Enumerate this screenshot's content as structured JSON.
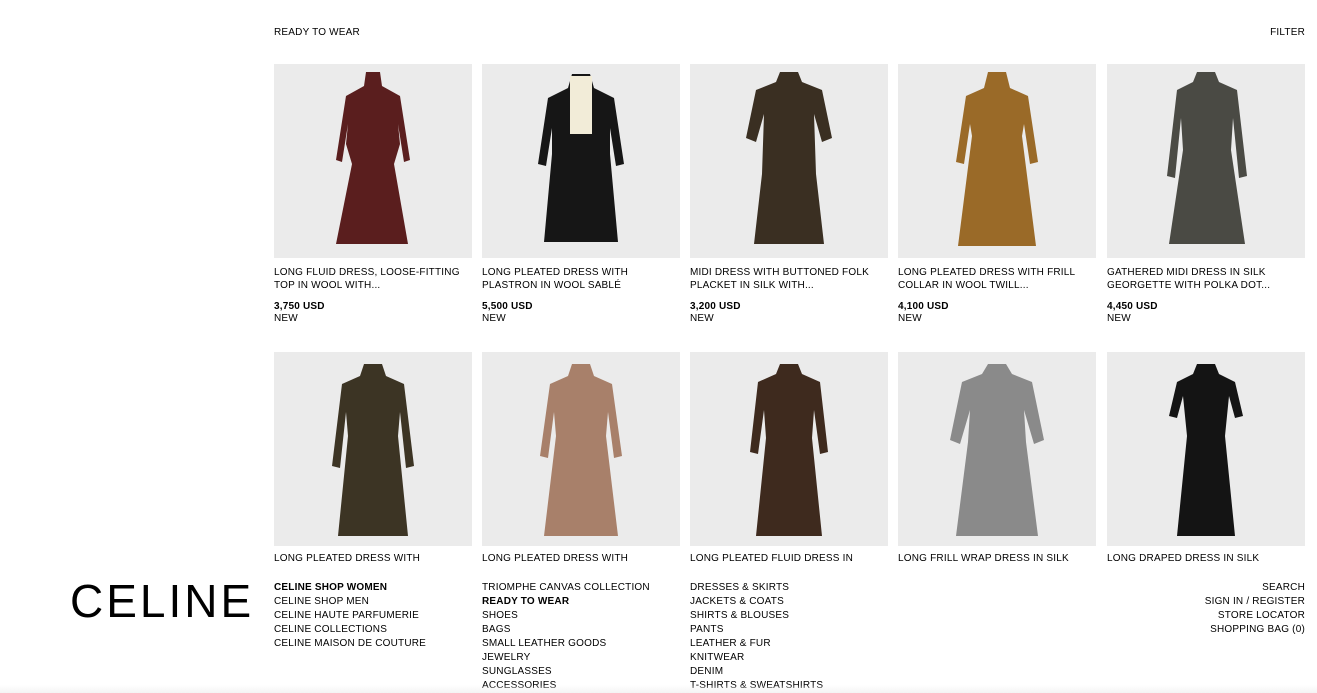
{
  "header": {
    "title": "READY TO WEAR",
    "filter_label": "FILTER"
  },
  "products_row1": [
    {
      "name": "LONG FLUID DRESS, LOOSE-FITTING TOP IN WOOL WITH...",
      "price": "3,750 USD",
      "badge": "NEW",
      "color": "#5a1e1e"
    },
    {
      "name": "LONG PLEATED DRESS WITH PLASTRON IN WOOL SABLÉ",
      "price": "5,500 USD",
      "badge": "NEW",
      "color": "#161616"
    },
    {
      "name": "MIDI DRESS WITH BUTTONED FOLK PLACKET IN SILK WITH...",
      "price": "3,200 USD",
      "badge": "NEW",
      "color": "#3a2f22"
    },
    {
      "name": "LONG PLEATED DRESS WITH FRILL COLLAR IN WOOL TWILL...",
      "price": "4,100 USD",
      "badge": "NEW",
      "color": "#9a6a28"
    },
    {
      "name": "GATHERED MIDI DRESS IN SILK GEORGETTE WITH POLKA DOT...",
      "price": "4,450 USD",
      "badge": "NEW",
      "color": "#4a4a44"
    }
  ],
  "products_row2": [
    {
      "name": "LONG PLEATED DRESS WITH",
      "color": "#3c3424"
    },
    {
      "name": "LONG PLEATED DRESS WITH",
      "color": "#a8806a"
    },
    {
      "name": "LONG PLEATED FLUID DRESS IN",
      "color": "#3e2a1e"
    },
    {
      "name": "LONG FRILL WRAP DRESS IN SILK",
      "color": "#8a8a8a"
    },
    {
      "name": "LONG DRAPED DRESS IN SILK",
      "color": "#141414"
    }
  ],
  "footer": {
    "logo": "CELINE",
    "col1": [
      "CELINE SHOP WOMEN",
      "CELINE SHOP MEN",
      "CELINE HAUTE PARFUMERIE",
      "CELINE COLLECTIONS",
      "CELINE MAISON DE COUTURE"
    ],
    "col2": [
      "TRIOMPHE CANVAS COLLECTION",
      "READY TO WEAR",
      "SHOES",
      "BAGS",
      "SMALL LEATHER GOODS",
      "JEWELRY",
      "SUNGLASSES",
      "ACCESSORIES"
    ],
    "col3": [
      "DRESSES & SKIRTS",
      "JACKETS & COATS",
      "SHIRTS & BLOUSES",
      "PANTS",
      "LEATHER & FUR",
      "KNITWEAR",
      "DENIM",
      "T-SHIRTS & SWEATSHIRTS"
    ],
    "col4": [
      "SEARCH",
      "SIGN IN / REGISTER",
      "STORE LOCATOR",
      "SHOPPING BAG (0)"
    ]
  }
}
